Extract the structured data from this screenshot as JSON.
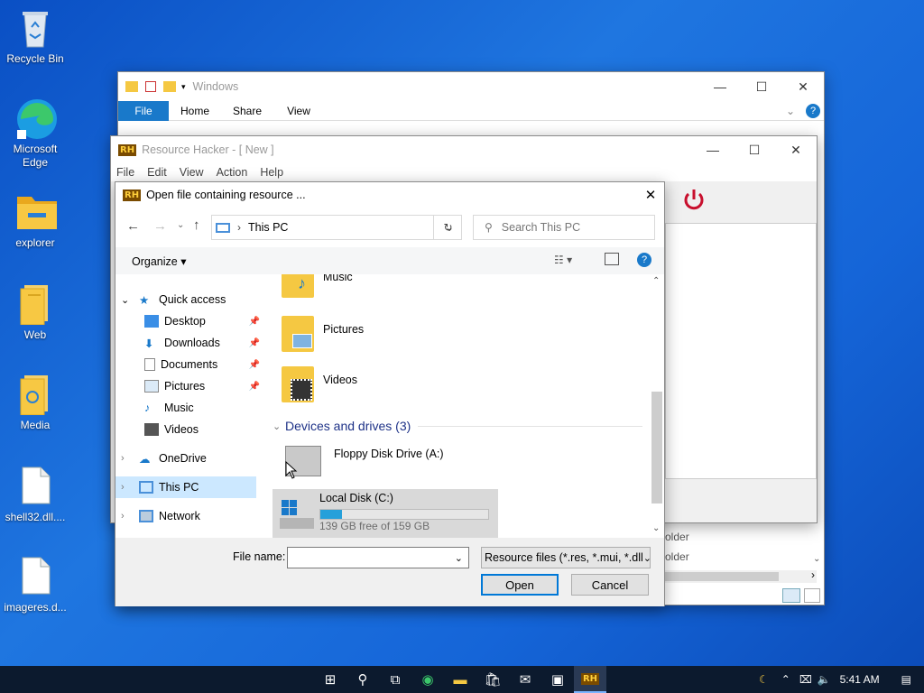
{
  "desktop": {
    "icons": [
      {
        "label": "Recycle Bin"
      },
      {
        "label": "Microsoft Edge"
      },
      {
        "label": "explorer"
      },
      {
        "label": "Web"
      },
      {
        "label": "Media"
      },
      {
        "label": "shell32.dll...."
      },
      {
        "label": "imageres.d..."
      }
    ]
  },
  "explorer_window": {
    "title": "Windows",
    "ribbon_tabs": [
      "File",
      "Home",
      "Share",
      "View"
    ],
    "status_rows": [
      "older",
      "older"
    ]
  },
  "rh_window": {
    "title": "Resource Hacker - [ New ]",
    "menu": [
      "File",
      "Edit",
      "View",
      "Action",
      "Help"
    ]
  },
  "dialog": {
    "title": "Open file containing resource ...",
    "address": "This PC",
    "search_placeholder": "Search This PC",
    "organize_label": "Organize",
    "nav": {
      "quick_access": "Quick access",
      "quick_items": [
        "Desktop",
        "Downloads",
        "Documents",
        "Pictures",
        "Music",
        "Videos"
      ],
      "onedrive": "OneDrive",
      "this_pc": "This PC",
      "network": "Network"
    },
    "folders": [
      "Music",
      "Pictures",
      "Videos"
    ],
    "devices_header": "Devices and drives (3)",
    "drives": [
      {
        "name": "Floppy Disk Drive (A:)"
      },
      {
        "name": "Local Disk (C:)",
        "free_text": "139 GB free of 159 GB",
        "used_fraction": 0.13
      }
    ],
    "file_name_label": "File name:",
    "file_name_value": "",
    "filter_label": "Resource files (*.res, *.mui, *.dll",
    "open_label": "Open",
    "cancel_label": "Cancel"
  },
  "taskbar": {
    "time": "5:41 AM"
  }
}
